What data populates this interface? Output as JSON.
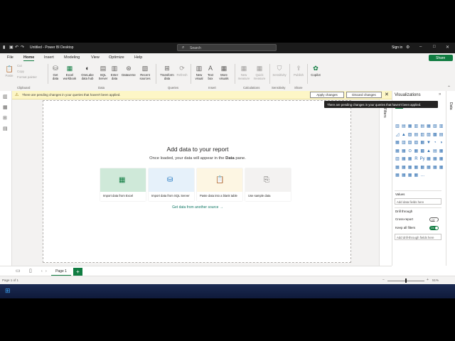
{
  "window": {
    "title": "Untitled - Power BI Desktop",
    "search_placeholder": "Search",
    "sign_in": "Sign in"
  },
  "menu": {
    "items": [
      "File",
      "Home",
      "Insert",
      "Modeling",
      "View",
      "Optimize",
      "Help"
    ],
    "share": "Share"
  },
  "ribbon": {
    "paste": "Paste",
    "cut": "Cut",
    "copy": "Copy",
    "format_painter": "Format painter",
    "get_data": "Get data",
    "excel": "Excel workbook",
    "onelake": "OneLake data hub",
    "sql": "SQL Server",
    "enter_data": "Enter data",
    "dataverse": "Dataverse",
    "recent_sources": "Recent sources",
    "transform": "Transform data",
    "refresh": "Refresh",
    "new_visual": "New visual",
    "text_box": "Text box",
    "more_visuals": "More visuals",
    "new_measure": "New measure",
    "quick_measure": "Quick measure",
    "sensitivity": "Sensitivity",
    "publish": "Publish",
    "copilot": "Copilot",
    "groups": {
      "clipboard": "Clipboard",
      "data": "Data",
      "queries": "Queries",
      "insert": "Insert",
      "calculations": "Calculations",
      "sensitivity": "Sensitivity",
      "share": "Share"
    }
  },
  "warning": {
    "text": "There are pending changes in your queries that haven't been applied.",
    "apply": "Apply changes",
    "discard": "Discard changes",
    "tooltip": "There are pending changes in your queries that haven't been applied."
  },
  "canvas": {
    "title": "Add data to your report",
    "subtitle_pre": "Once loaded, your data will appear in the ",
    "subtitle_bold": "Data",
    "subtitle_post": " pane.",
    "cards": [
      {
        "label": "Import data from Excel",
        "color": "#cfe9d9",
        "icon_color": "#107c41"
      },
      {
        "label": "Import data from SQL Server",
        "color": "#e6f1fa",
        "icon_color": "#0f6cbd"
      },
      {
        "label": "Paste data into a blank table",
        "color": "#fdf6e3",
        "icon_color": "#c19c00"
      },
      {
        "label": "Use sample data",
        "color": "#f3f2f1",
        "icon_color": "#605e5c"
      }
    ],
    "another_source": "Get data from another source →"
  },
  "filters": {
    "label": "Filters"
  },
  "viz": {
    "title": "Visualizations",
    "values_label": "Values",
    "values_well": "Add data fields here",
    "drill_through": "Drill through",
    "cross_report": "Cross-report",
    "cross_report_toggle": "Off",
    "keep_filters": "Keep all filters",
    "keep_filters_toggle": "On",
    "drill_well": "Add drill-through fields here"
  },
  "data_pane": {
    "label": "Data"
  },
  "pages": {
    "tab": "Page 1"
  },
  "status": {
    "page": "Page 1 of 1",
    "zoom": "51%"
  }
}
